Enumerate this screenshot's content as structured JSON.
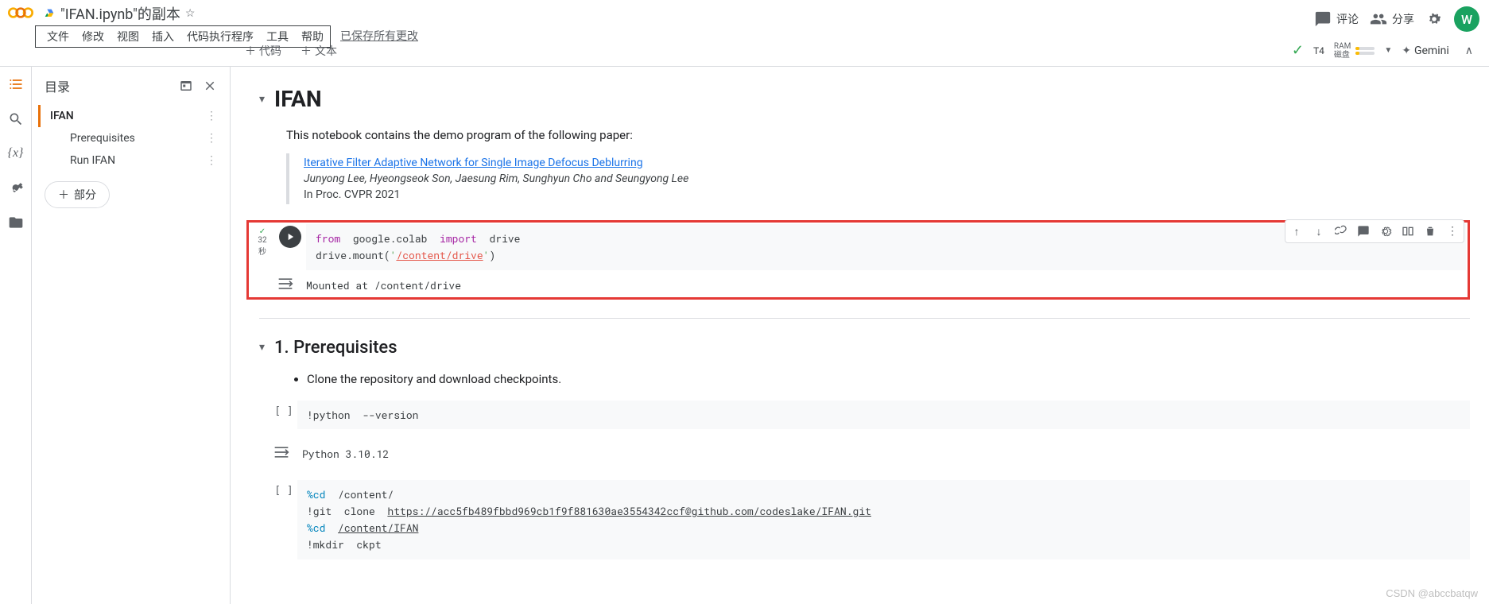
{
  "header": {
    "doc_title": "\"IFAN.ipynb\"的副本",
    "menu": [
      "文件",
      "修改",
      "视图",
      "插入",
      "代码执行程序",
      "工具",
      "帮助"
    ],
    "save_status": "已保存所有更改",
    "comment_label": "评论",
    "share_label": "分享",
    "avatar_letter": "W"
  },
  "toolbar": {
    "add_code": "代码",
    "add_text": "文本",
    "runtime_type": "T4",
    "ram_label": "RAM",
    "disk_label": "磁盘",
    "gemini_label": "Gemini"
  },
  "sidebar": {
    "title": "目录",
    "items": [
      {
        "label": "IFAN",
        "active": true,
        "indent": false
      },
      {
        "label": "Prerequisites",
        "active": false,
        "indent": true
      },
      {
        "label": "Run IFAN",
        "active": false,
        "indent": true
      }
    ],
    "add_section": "部分"
  },
  "notebook": {
    "h1": "IFAN",
    "intro": "This notebook contains the demo program of the following paper:",
    "paper_link": "Iterative Filter Adaptive Network for Single Image Defocus Deblurring",
    "authors": "Junyong Lee, Hyeongseok Son, Jaesung Rim, Sunghyun Cho and Seungyong Lee",
    "venue": "In Proc. CVPR 2021",
    "cell1": {
      "exec_time": "32",
      "exec_unit": "秒",
      "code_tokens": {
        "from": "from",
        "pkg": "  google.colab  ",
        "import": "import",
        "mod": "  drive",
        "line2a": "drive.mount(",
        "line2b": "'",
        "line2c": "/content/drive",
        "line2d": "'",
        "line2e": ")"
      },
      "output": "Mounted at /content/drive"
    },
    "h2": "1. Prerequisites",
    "bullet1": "Clone the repository and download checkpoints.",
    "cell2": {
      "code": "!python  --version",
      "output": "Python 3.10.12"
    },
    "cell3": {
      "line1a": "%cd",
      "line1b": "  /content/",
      "line2a": "!git  clone  ",
      "line2b": "https://acc5fb489fbbd969cb1f9f881630ae3554342ccf@github.com/codeslake/IFAN.git",
      "line3a": "%cd",
      "line3b": "  ",
      "line3c": "/content/IFAN",
      "line4": "!mkdir  ckpt"
    }
  },
  "watermark": "CSDN @abccbatqw"
}
